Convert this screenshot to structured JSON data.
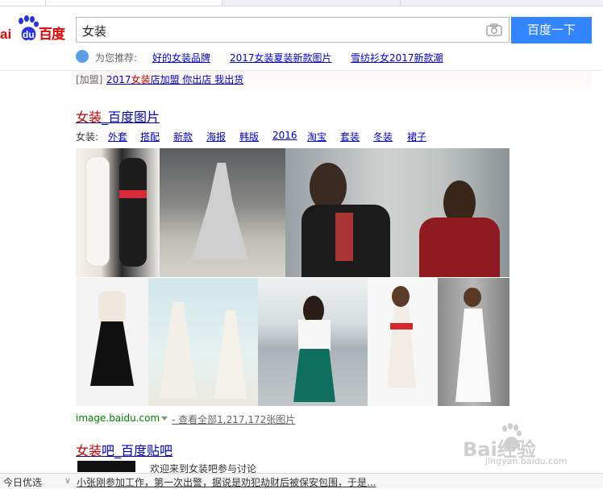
{
  "header": {
    "search_query": "女装",
    "search_button": "百度一下",
    "logo_text": "百度"
  },
  "suggest": {
    "label": "为您推荐:",
    "items": [
      "好的女装品牌",
      "2017女装夏装新款图片",
      "雪纺衫女2017新款潮"
    ]
  },
  "ad": {
    "tag": "[加盟]",
    "prefix": "2017",
    "keyword": "女装",
    "rest": "店加盟 你出店 我出货"
  },
  "result1": {
    "title_keyword": "女装",
    "title_rest": "_百度图片",
    "category_label": "女装:",
    "categories": [
      "外套",
      "搭配",
      "新款",
      "海报",
      "韩版",
      "2016",
      "淘宝",
      "套装",
      "冬装",
      "裙子"
    ],
    "source": "image.baidu.com",
    "view_all": "- 查看全部1,217,172张图片"
  },
  "result2": {
    "title_keyword": "女装",
    "title_rest": "吧_百度贴吧",
    "snippet": "欢迎来到女装吧参与讨论"
  },
  "news_bar": {
    "label": "今日优选",
    "text": "小张刚参加工作，第一次出警，据说是劝犯劫财后被保安包围，于是..."
  },
  "watermark": {
    "brand": "Bai经验",
    "url": "jingyan.baidu.com"
  },
  "colors": {
    "accent": "#3385ff",
    "link": "#0000cc",
    "keyword": "#cc0000",
    "source": "#008000"
  }
}
